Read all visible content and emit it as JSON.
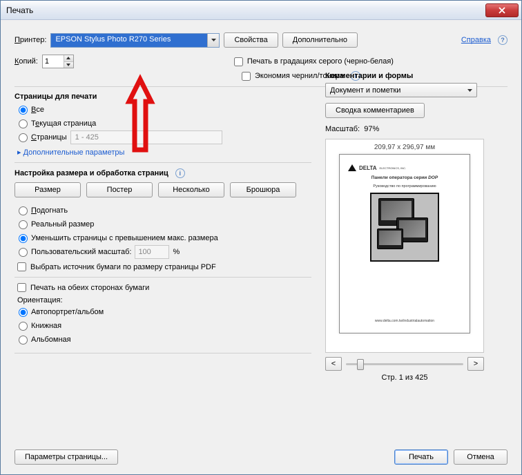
{
  "window": {
    "title": "Печать"
  },
  "header": {
    "printer_label": "Принтер:",
    "printer_selected": "EPSON Stylus Photo R270 Series",
    "properties_btn": "Свойства",
    "advanced_btn": "Дополнительно",
    "help_link": "Справка",
    "copies_label": "Копий:",
    "copies_value": "1",
    "grayscale_label": "Печать в градациях серого (черно-белая)",
    "ink_save_label": "Экономия чернил/тонера"
  },
  "pages": {
    "section_title": "Страницы для печати",
    "all_label": "Все",
    "current_label": "Текущая страница",
    "range_label": "Страницы",
    "range_value": "1 - 425",
    "more_params": "Дополнительные параметры"
  },
  "sizing": {
    "section_title": "Настройка размера и обработка страниц",
    "tab_size": "Размер",
    "tab_poster": "Постер",
    "tab_multi": "Несколько",
    "tab_booklet": "Брошюра",
    "fit_label": "Подогнать",
    "actual_label": "Реальный размер",
    "shrink_label": "Уменьшить страницы с превышением макс. размера",
    "custom_scale_label": "Пользовательский масштаб:",
    "scale_value": "100",
    "scale_unit": "%",
    "paper_source_label": "Выбрать источник бумаги по размеру страницы PDF",
    "duplex_label": "Печать на обеих сторонах бумаги",
    "orientation_label": "Ориентация:",
    "orient_auto": "Автопортрет/альбом",
    "orient_portrait": "Книжная",
    "orient_landscape": "Альбомная"
  },
  "comments": {
    "section_title": "Комментарии и формы",
    "dropdown_value": "Документ и пометки",
    "summary_btn": "Сводка комментариев",
    "scale_label": "Масштаб:",
    "scale_value": "97%"
  },
  "preview": {
    "paper_dim": "209,97 x 296,97 мм",
    "doc_brand": "DELTA",
    "doc_brand_sub": "ELECTRONICS, INC.",
    "doc_line1": "Панели оператора серии DOP",
    "doc_line2": "Руководство по программированию",
    "doc_url": "www.delta.com.tw/industrialautomation",
    "nav_prev": "<",
    "nav_next": ">",
    "page_status": "Стр. 1 из 425"
  },
  "footer": {
    "page_setup_btn": "Параметры страницы...",
    "print_btn": "Печать",
    "cancel_btn": "Отмена"
  }
}
